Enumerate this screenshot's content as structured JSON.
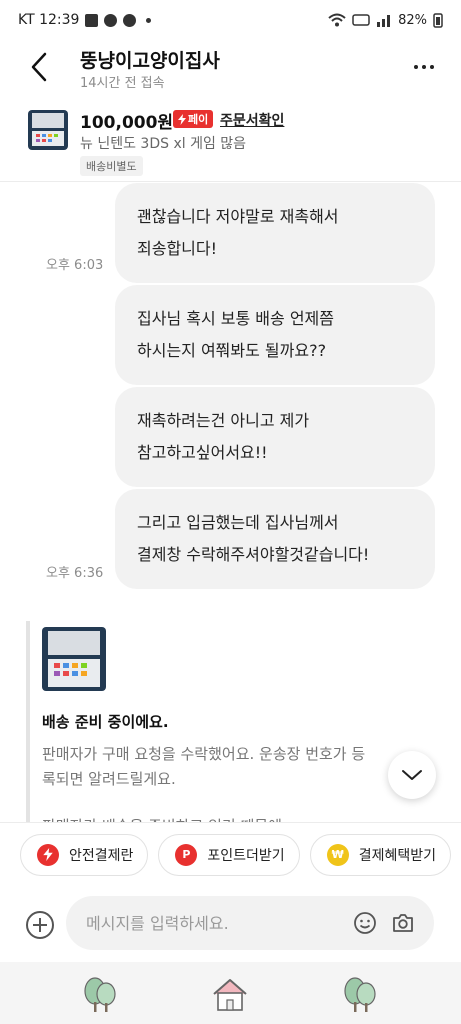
{
  "status_bar": {
    "carrier_time": "KT 12:39",
    "battery": "82%"
  },
  "header": {
    "seller_name": "뚱냥이고양이집사",
    "last_seen": "14시간 전 접속"
  },
  "product": {
    "price": "100,000원",
    "pay_badge": "페이",
    "order_link": "주문서확인",
    "name": "뉴 닌텐도 3DS xl 게임 많음",
    "shipping_tag": "배송비별도"
  },
  "messages": [
    {
      "lines": [
        "괜찮습니다 저야말로 재촉해서",
        "죄송합니다!"
      ],
      "time": "오후 6:03"
    },
    {
      "lines": [
        "집사님 혹시 보통 배송 언제쯤",
        "하시는지 여쭤봐도 될까요??"
      ],
      "time": ""
    },
    {
      "lines": [
        "재촉하려는건 아니고 제가",
        "참고하고싶어서요!!"
      ],
      "time": ""
    },
    {
      "lines": [
        "그리고 입금했는데 집사님께서",
        "결제창 수락해주셔야할것같습니다!"
      ],
      "time": "오후 6:36"
    }
  ],
  "system_card": {
    "title": "배송 준비 중이에요.",
    "text1": "판매자가 구매 요청을 수락했어요. 운송장 번호가 등록되면 알려드릴게요.",
    "text2": "판매자가 배송을 준비하고 있기 때문에"
  },
  "quick_actions": [
    {
      "label": "안전결제란",
      "icon": "lightning-icon",
      "color": "#e8312f"
    },
    {
      "label": "포인트더받기",
      "icon": "point-p-icon",
      "color": "#e8312f"
    },
    {
      "label": "결제혜택받기",
      "icon": "won-coin-icon",
      "color": "#f0c419"
    }
  ],
  "composer": {
    "placeholder": "메시지를 입력하세요."
  },
  "colors": {
    "accent": "#e8312f",
    "bubble": "#f2f2f2"
  }
}
